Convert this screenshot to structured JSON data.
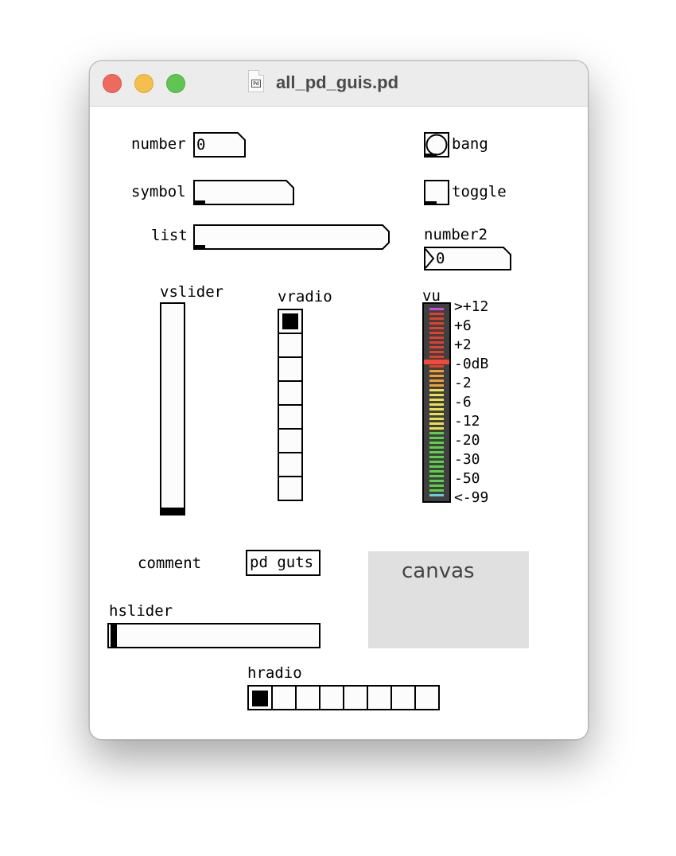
{
  "window": {
    "title": "all_pd_guis.pd",
    "doc_icon_badge": "Pd"
  },
  "widgets": {
    "number": {
      "label": "number",
      "value": "0"
    },
    "symbol": {
      "label": "symbol"
    },
    "list": {
      "label": "list"
    },
    "bang": {
      "label": "bang"
    },
    "toggle": {
      "label": "toggle",
      "checked": false
    },
    "number2": {
      "label": "number2",
      "value": "0"
    },
    "vslider": {
      "label": "vslider",
      "level": 0
    },
    "vradio": {
      "label": "vradio",
      "count": 8,
      "selected": 0
    },
    "vu": {
      "label": "vu",
      "scale": [
        ">+12",
        "+6",
        "+2",
        "-0dB",
        "-2",
        "-6",
        "-12",
        "-20",
        "-30",
        "-50",
        "<-99"
      ],
      "colors": {
        "top": "#c850e0",
        "red": "#e0402c",
        "orange": "#f0a030",
        "yellow": "#e8e050",
        "green": "#5cd048",
        "bottom": "#60d0e0",
        "peak": "#f04a3a"
      }
    },
    "comment": {
      "text": "comment"
    },
    "pd_object": {
      "text": "pd guts"
    },
    "canvas": {
      "text": "canvas",
      "color": "#e0e0e0"
    },
    "hslider": {
      "label": "hslider",
      "level": 0
    },
    "hradio": {
      "label": "hradio",
      "count": 8,
      "selected": 0
    }
  }
}
